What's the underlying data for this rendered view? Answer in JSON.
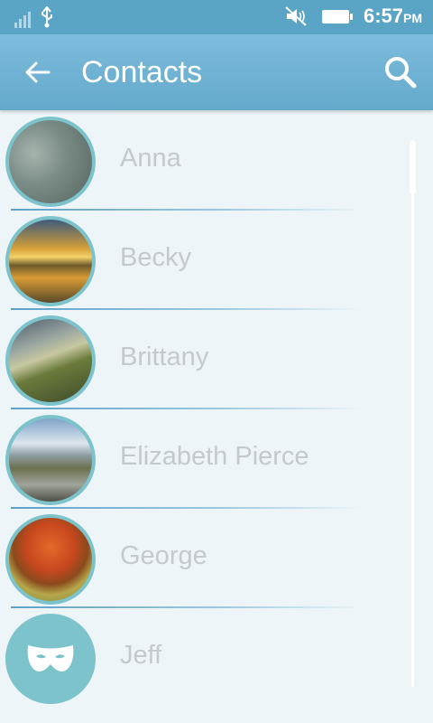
{
  "status_bar": {
    "time": "6:57",
    "ampm": "PM",
    "icons": [
      "signal-icon",
      "usb-icon",
      "mute-icon",
      "battery-icon"
    ]
  },
  "app_bar": {
    "title": "Contacts",
    "back_icon": "arrow-left-icon",
    "search_icon": "search-icon"
  },
  "contacts": [
    {
      "name": "Anna",
      "avatar": "photo"
    },
    {
      "name": "Becky",
      "avatar": "photo"
    },
    {
      "name": "Brittany",
      "avatar": "photo"
    },
    {
      "name": "Elizabeth Pierce",
      "avatar": "photo"
    },
    {
      "name": "George",
      "avatar": "photo"
    },
    {
      "name": "Jeff",
      "avatar": "mask-icon"
    }
  ],
  "colors": {
    "status_bar": "#5aa4c6",
    "app_bar": "#6fb1d3",
    "avatar_ring": "#7cc3cc",
    "name_text": "#c5c9cc",
    "background": "#eef5f9"
  }
}
